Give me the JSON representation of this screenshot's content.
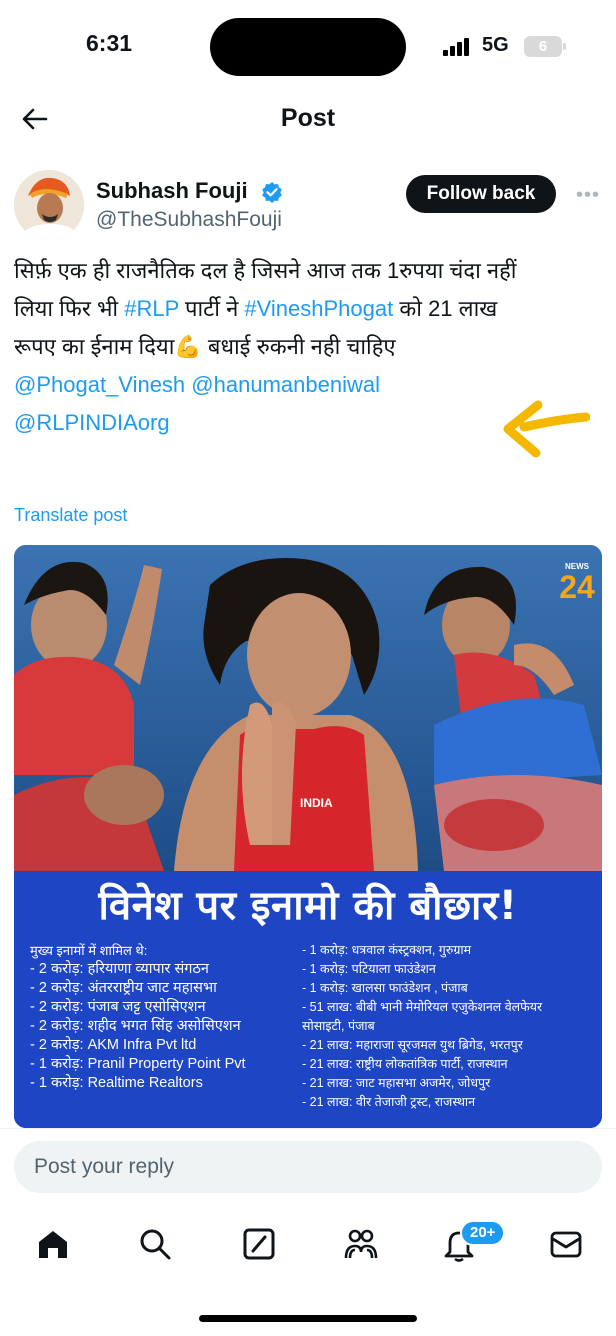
{
  "status_bar": {
    "time": "6:31",
    "network": "5G",
    "battery": "6"
  },
  "header": {
    "title": "Post"
  },
  "author": {
    "name": "Subhash Fouji",
    "handle": "@TheSubhashFouji",
    "follow_label": "Follow back"
  },
  "post": {
    "line1": "सिर्फ़ एक ही राजनैतिक दल है जिसने आज तक 1रुपया चंदा नहीं",
    "line2_a": "लिया फिर भी ",
    "line2_tag1": "#RLP",
    "line2_b": " पार्टी ने ",
    "line2_tag2": "#VineshPhogat",
    "line2_c": " को 21 लाख",
    "line3": "रूपए का ईनाम दिया💪 बधाई रुकनी नही चाहिए",
    "mention1": "@Phogat_Vinesh",
    "mention2": "@hanumanbeniwal",
    "mention3": "@RLPINDIAorg",
    "translate_label": "Translate post"
  },
  "media": {
    "banner_title": "विनेश पर इनामो की बौछार!",
    "left_items": [
      "मुख्य इनामों में शामिल थे:",
      "- 2 करोड़: हरियाणा व्यापार संगठन",
      "- 2 करोड़: अंतरराष्ट्रीय जाट महासभा",
      "- 2 करोड़: पंजाब जट्ट एसोसिएशन",
      "- 2 करोड़: शहीद भगत सिंह असोसिएशन",
      "- 2 करोड़: AKM Infra Pvt ltd",
      "- 1 करोड़: Pranil Property Point Pvt",
      "- 1 करोड़: Realtime Realtors"
    ],
    "right_items": [
      "- 1 करोड़: धत्रवाल कंस्ट्रक्शन, गुरुग्राम",
      "- 1 करोड़: पटियाला फाउंडेशन",
      "- 1 करोड़: खालसा फाउंडेशन , पंजाब",
      "- 51 लाख: बीबी भानी मेमोरियल एजुकेशनल वेलफेयर",
      "सोसाइटी, पंजाब",
      "- 21 लाख: महाराजा सूरजमल युथ ब्रिगेड, भरतपुर",
      "- 21 लाख: राष्ट्रीय लोकतांत्रिक पार्टी, राजस्थान",
      "- 21 लाख: जाट महासभा अजमेर, जोधपुर",
      "- 21 लाख: वीर तेजाजी ट्रस्ट, राजस्थान"
    ],
    "logo_top": "NEWS",
    "logo_num": "24",
    "shirt_text": "INDIA"
  },
  "reply": {
    "placeholder": "Post your reply"
  },
  "nav": {
    "notifications_badge": "20+"
  },
  "colors": {
    "accent": "#1d9bf0",
    "banner": "#1e45c4",
    "follow_bg": "#0f1419"
  }
}
